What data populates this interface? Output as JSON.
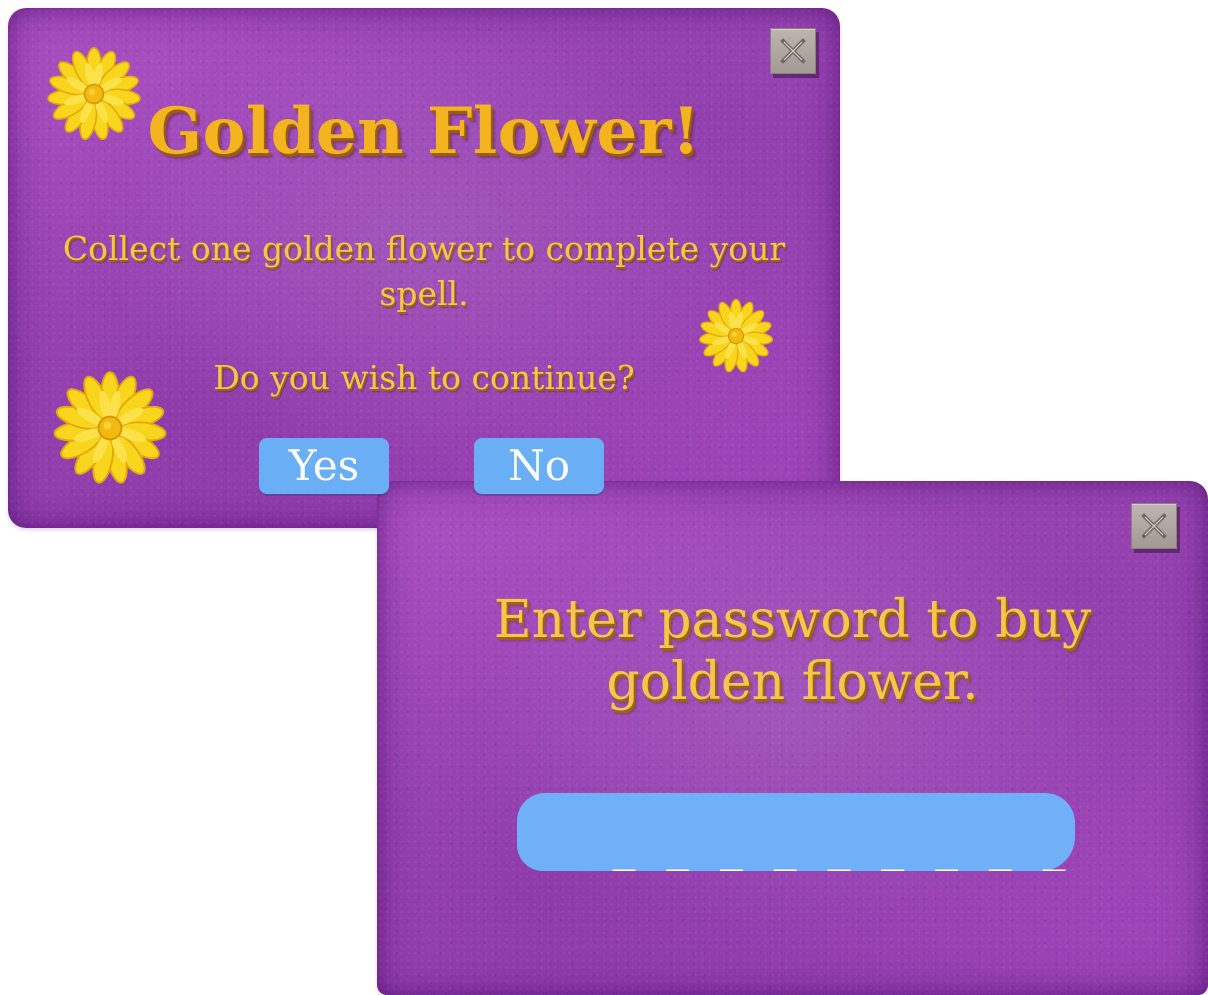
{
  "dialog_1": {
    "title": "Golden Flower!",
    "message": "Collect one golden flower to complete your spell.",
    "question": "Do you wish to continue?",
    "yes_label": "Yes",
    "no_label": "No",
    "close_icon": "close-icon"
  },
  "dialog_2": {
    "prompt": "Enter password to buy golden flower.",
    "password_mask": "_ _ _ _ _ _ _ _ _",
    "close_icon": "close-icon"
  },
  "colors": {
    "dialog_purple": "#a24bbd",
    "gold_text": "#f4b420",
    "button_blue": "#6aaef5",
    "flower_yellow": "#f7d21c"
  },
  "icons": [
    "golden-flower-icon",
    "close-icon"
  ]
}
